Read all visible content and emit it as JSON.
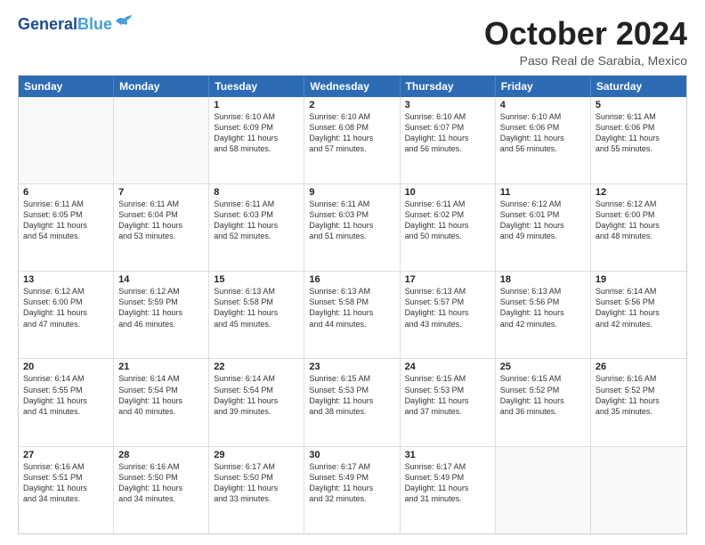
{
  "logo": {
    "line1": "General",
    "line2": "Blue"
  },
  "title": "October 2024",
  "location": "Paso Real de Sarabia, Mexico",
  "days_header": [
    "Sunday",
    "Monday",
    "Tuesday",
    "Wednesday",
    "Thursday",
    "Friday",
    "Saturday"
  ],
  "weeks": [
    [
      {
        "day": "",
        "lines": []
      },
      {
        "day": "",
        "lines": []
      },
      {
        "day": "1",
        "lines": [
          "Sunrise: 6:10 AM",
          "Sunset: 6:09 PM",
          "Daylight: 11 hours",
          "and 58 minutes."
        ]
      },
      {
        "day": "2",
        "lines": [
          "Sunrise: 6:10 AM",
          "Sunset: 6:08 PM",
          "Daylight: 11 hours",
          "and 57 minutes."
        ]
      },
      {
        "day": "3",
        "lines": [
          "Sunrise: 6:10 AM",
          "Sunset: 6:07 PM",
          "Daylight: 11 hours",
          "and 56 minutes."
        ]
      },
      {
        "day": "4",
        "lines": [
          "Sunrise: 6:10 AM",
          "Sunset: 6:06 PM",
          "Daylight: 11 hours",
          "and 56 minutes."
        ]
      },
      {
        "day": "5",
        "lines": [
          "Sunrise: 6:11 AM",
          "Sunset: 6:06 PM",
          "Daylight: 11 hours",
          "and 55 minutes."
        ]
      }
    ],
    [
      {
        "day": "6",
        "lines": [
          "Sunrise: 6:11 AM",
          "Sunset: 6:05 PM",
          "Daylight: 11 hours",
          "and 54 minutes."
        ]
      },
      {
        "day": "7",
        "lines": [
          "Sunrise: 6:11 AM",
          "Sunset: 6:04 PM",
          "Daylight: 11 hours",
          "and 53 minutes."
        ]
      },
      {
        "day": "8",
        "lines": [
          "Sunrise: 6:11 AM",
          "Sunset: 6:03 PM",
          "Daylight: 11 hours",
          "and 52 minutes."
        ]
      },
      {
        "day": "9",
        "lines": [
          "Sunrise: 6:11 AM",
          "Sunset: 6:03 PM",
          "Daylight: 11 hours",
          "and 51 minutes."
        ]
      },
      {
        "day": "10",
        "lines": [
          "Sunrise: 6:11 AM",
          "Sunset: 6:02 PM",
          "Daylight: 11 hours",
          "and 50 minutes."
        ]
      },
      {
        "day": "11",
        "lines": [
          "Sunrise: 6:12 AM",
          "Sunset: 6:01 PM",
          "Daylight: 11 hours",
          "and 49 minutes."
        ]
      },
      {
        "day": "12",
        "lines": [
          "Sunrise: 6:12 AM",
          "Sunset: 6:00 PM",
          "Daylight: 11 hours",
          "and 48 minutes."
        ]
      }
    ],
    [
      {
        "day": "13",
        "lines": [
          "Sunrise: 6:12 AM",
          "Sunset: 6:00 PM",
          "Daylight: 11 hours",
          "and 47 minutes."
        ]
      },
      {
        "day": "14",
        "lines": [
          "Sunrise: 6:12 AM",
          "Sunset: 5:59 PM",
          "Daylight: 11 hours",
          "and 46 minutes."
        ]
      },
      {
        "day": "15",
        "lines": [
          "Sunrise: 6:13 AM",
          "Sunset: 5:58 PM",
          "Daylight: 11 hours",
          "and 45 minutes."
        ]
      },
      {
        "day": "16",
        "lines": [
          "Sunrise: 6:13 AM",
          "Sunset: 5:58 PM",
          "Daylight: 11 hours",
          "and 44 minutes."
        ]
      },
      {
        "day": "17",
        "lines": [
          "Sunrise: 6:13 AM",
          "Sunset: 5:57 PM",
          "Daylight: 11 hours",
          "and 43 minutes."
        ]
      },
      {
        "day": "18",
        "lines": [
          "Sunrise: 6:13 AM",
          "Sunset: 5:56 PM",
          "Daylight: 11 hours",
          "and 42 minutes."
        ]
      },
      {
        "day": "19",
        "lines": [
          "Sunrise: 6:14 AM",
          "Sunset: 5:56 PM",
          "Daylight: 11 hours",
          "and 42 minutes."
        ]
      }
    ],
    [
      {
        "day": "20",
        "lines": [
          "Sunrise: 6:14 AM",
          "Sunset: 5:55 PM",
          "Daylight: 11 hours",
          "and 41 minutes."
        ]
      },
      {
        "day": "21",
        "lines": [
          "Sunrise: 6:14 AM",
          "Sunset: 5:54 PM",
          "Daylight: 11 hours",
          "and 40 minutes."
        ]
      },
      {
        "day": "22",
        "lines": [
          "Sunrise: 6:14 AM",
          "Sunset: 5:54 PM",
          "Daylight: 11 hours",
          "and 39 minutes."
        ]
      },
      {
        "day": "23",
        "lines": [
          "Sunrise: 6:15 AM",
          "Sunset: 5:53 PM",
          "Daylight: 11 hours",
          "and 38 minutes."
        ]
      },
      {
        "day": "24",
        "lines": [
          "Sunrise: 6:15 AM",
          "Sunset: 5:53 PM",
          "Daylight: 11 hours",
          "and 37 minutes."
        ]
      },
      {
        "day": "25",
        "lines": [
          "Sunrise: 6:15 AM",
          "Sunset: 5:52 PM",
          "Daylight: 11 hours",
          "and 36 minutes."
        ]
      },
      {
        "day": "26",
        "lines": [
          "Sunrise: 6:16 AM",
          "Sunset: 5:52 PM",
          "Daylight: 11 hours",
          "and 35 minutes."
        ]
      }
    ],
    [
      {
        "day": "27",
        "lines": [
          "Sunrise: 6:16 AM",
          "Sunset: 5:51 PM",
          "Daylight: 11 hours",
          "and 34 minutes."
        ]
      },
      {
        "day": "28",
        "lines": [
          "Sunrise: 6:16 AM",
          "Sunset: 5:50 PM",
          "Daylight: 11 hours",
          "and 34 minutes."
        ]
      },
      {
        "day": "29",
        "lines": [
          "Sunrise: 6:17 AM",
          "Sunset: 5:50 PM",
          "Daylight: 11 hours",
          "and 33 minutes."
        ]
      },
      {
        "day": "30",
        "lines": [
          "Sunrise: 6:17 AM",
          "Sunset: 5:49 PM",
          "Daylight: 11 hours",
          "and 32 minutes."
        ]
      },
      {
        "day": "31",
        "lines": [
          "Sunrise: 6:17 AM",
          "Sunset: 5:49 PM",
          "Daylight: 11 hours",
          "and 31 minutes."
        ]
      },
      {
        "day": "",
        "lines": []
      },
      {
        "day": "",
        "lines": []
      }
    ]
  ]
}
